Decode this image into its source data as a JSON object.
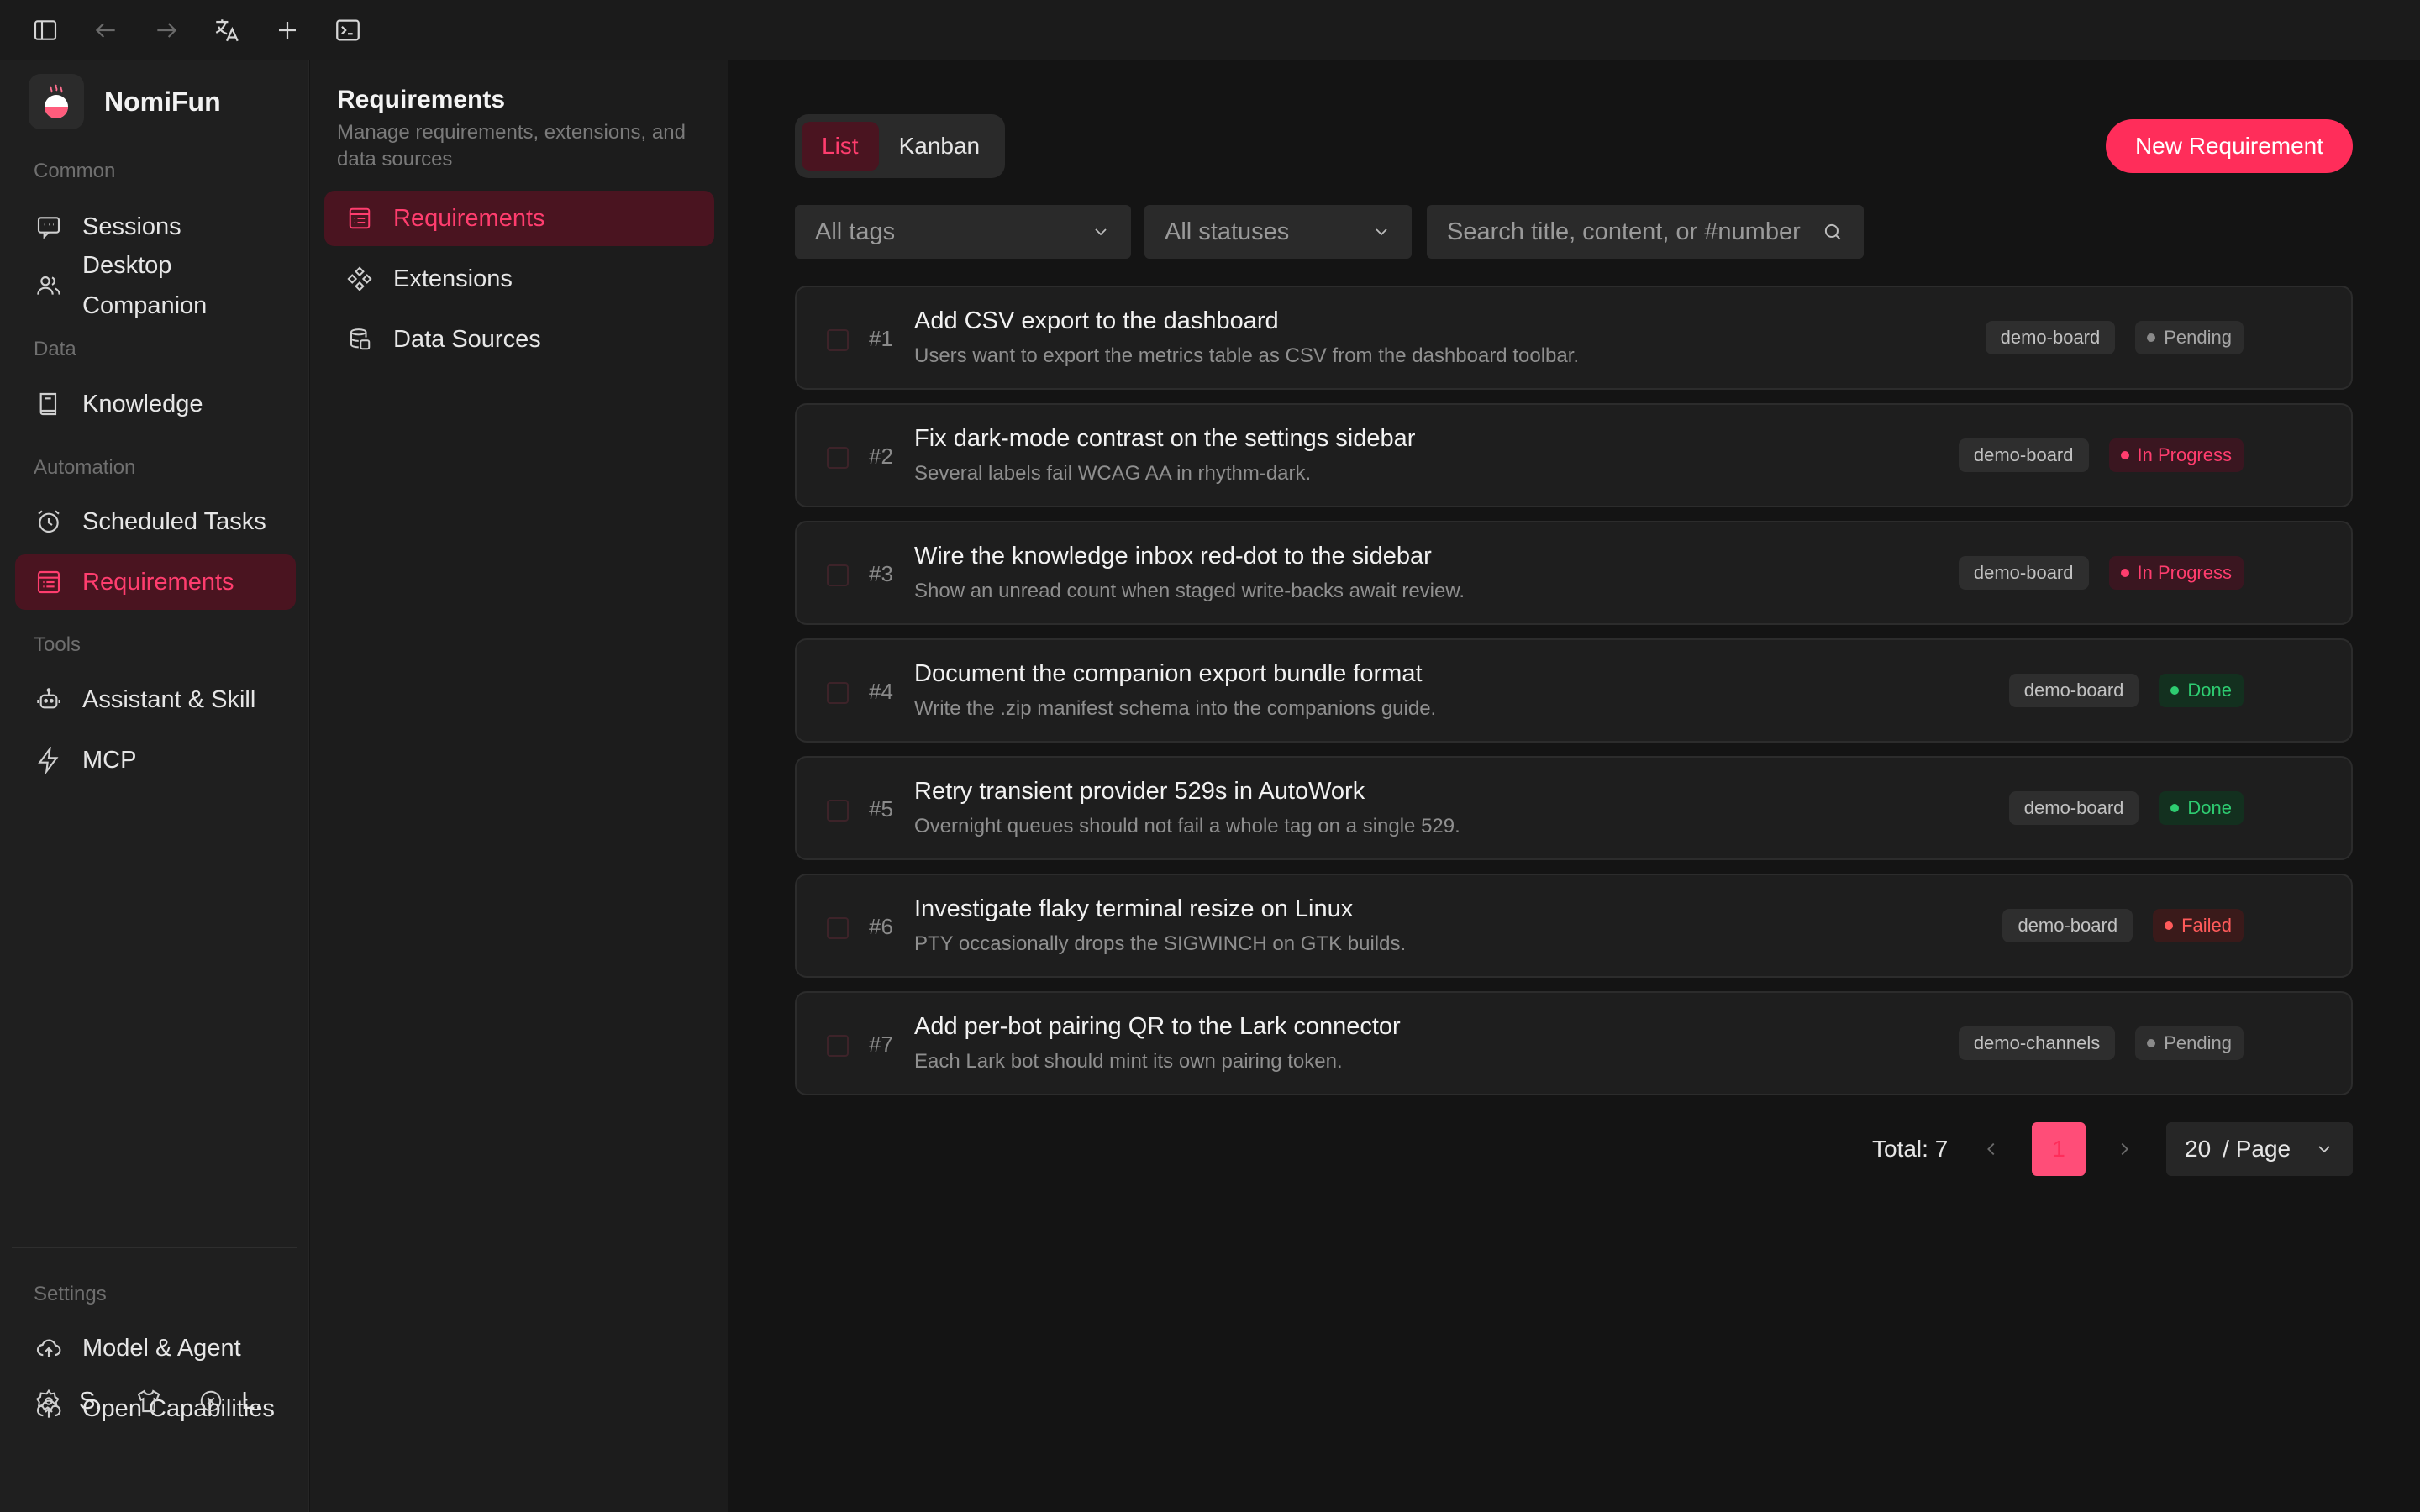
{
  "app": {
    "name": "NomiFun"
  },
  "topbar": {
    "icons": [
      "sidebar-toggle-icon",
      "back-arrow-icon",
      "forward-arrow-icon",
      "translate-icon",
      "plus-icon",
      "terminal-icon"
    ]
  },
  "sidebar": {
    "sections": {
      "common": "Common",
      "data": "Data",
      "automation": "Automation",
      "tools": "Tools",
      "settings": "Settings"
    },
    "items": {
      "sessions": "Sessions",
      "desktop_companion": "Desktop Companion",
      "knowledge": "Knowledge",
      "scheduled_tasks": "Scheduled Tasks",
      "requirements": "Requirements",
      "assistant_skill": "Assistant & Skill",
      "mcp": "MCP",
      "model_agent": "Model & Agent",
      "open_capabilities": "Open Capabilities"
    },
    "bottom": {
      "s_label": "S.",
      "l_label": "L."
    },
    "active": "requirements"
  },
  "subsidebar": {
    "title": "Requirements",
    "description": "Manage requirements, extensions, and data sources",
    "items": [
      "Requirements",
      "Extensions",
      "Data Sources"
    ],
    "active": 0
  },
  "main": {
    "view_tabs": [
      "List",
      "Kanban"
    ],
    "active_view": "List",
    "new_button": "New Requirement",
    "filters": {
      "tags": "All tags",
      "statuses": "All statuses",
      "search_placeholder": "Search title, content, or #number"
    },
    "requirements": [
      {
        "num": "#1",
        "title": "Add CSV export to the dashboard",
        "desc": "Users want to export the metrics table as CSV from the dashboard toolbar.",
        "tag": "demo-board",
        "status": "Pending",
        "status_kind": "pending"
      },
      {
        "num": "#2",
        "title": "Fix dark-mode contrast on the settings sidebar",
        "desc": "Several labels fail WCAG AA in rhythm-dark.",
        "tag": "demo-board",
        "status": "In Progress",
        "status_kind": "progress"
      },
      {
        "num": "#3",
        "title": "Wire the knowledge inbox red-dot to the sidebar",
        "desc": "Show an unread count when staged write-backs await review.",
        "tag": "demo-board",
        "status": "In Progress",
        "status_kind": "progress"
      },
      {
        "num": "#4",
        "title": "Document the companion export bundle format",
        "desc": "Write the .zip manifest schema into the companions guide.",
        "tag": "demo-board",
        "status": "Done",
        "status_kind": "done"
      },
      {
        "num": "#5",
        "title": "Retry transient provider 529s in AutoWork",
        "desc": "Overnight queues should not fail a whole tag on a single 529.",
        "tag": "demo-board",
        "status": "Done",
        "status_kind": "done"
      },
      {
        "num": "#6",
        "title": "Investigate flaky terminal resize on Linux",
        "desc": "PTY occasionally drops the SIGWINCH on GTK builds.",
        "tag": "demo-board",
        "status": "Failed",
        "status_kind": "failed"
      },
      {
        "num": "#7",
        "title": "Add per-bot pairing QR to the Lark connector",
        "desc": "Each Lark bot should mint its own pairing token.",
        "tag": "demo-channels",
        "status": "Pending",
        "status_kind": "pending"
      }
    ],
    "pagination": {
      "total_label": "Total: 7",
      "current_page": "1",
      "page_size": "20",
      "page_size_suffix": "/ Page"
    }
  },
  "colors": {
    "accent": "#ff2d5a",
    "active_bg": "#4a1420",
    "done": "#2ecc71",
    "failed": "#ff5a5a"
  }
}
